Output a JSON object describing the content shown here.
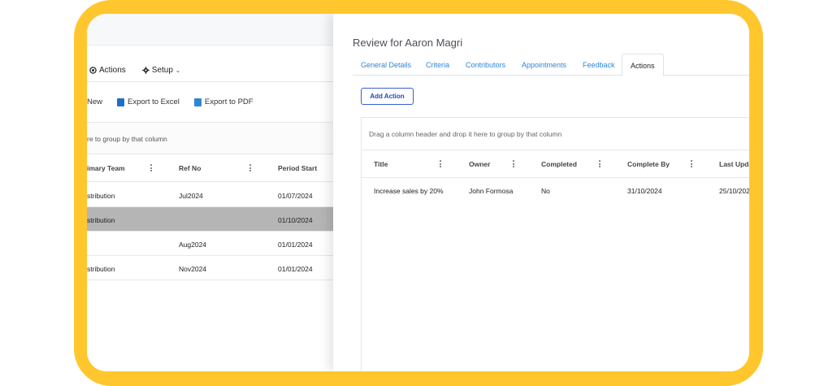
{
  "background": {
    "menu": [
      {
        "label": "Actions",
        "icon": "target-icon"
      },
      {
        "label": "Setup",
        "icon": "gear-icon"
      }
    ],
    "toolbar": {
      "new_label": "New",
      "export_excel_label": "Export to Excel",
      "export_pdf_label": "Export to PDF"
    },
    "group_hint": "re to group by that column",
    "columns": [
      "imary Team",
      "Ref No",
      "Period Start"
    ],
    "rows": [
      {
        "team": "stribution",
        "ref": "Jul2024",
        "start": "01/07/2024"
      },
      {
        "team": "stribution",
        "ref": "",
        "start": "01/10/2024"
      },
      {
        "team": "",
        "ref": "Aug2024",
        "start": "01/01/2024"
      },
      {
        "team": "stribution",
        "ref": "Nov2024",
        "start": "01/01/2024"
      }
    ]
  },
  "panel": {
    "title": "Review for Aaron Magri",
    "tabs": [
      "General Details",
      "Criteria",
      "Contributors",
      "Appointments",
      "Feedback",
      "Actions"
    ],
    "active_tab": "Actions",
    "add_button": "Add Action",
    "group_hint": "Drag a column header and drop it here to group by that column",
    "columns": [
      "Title",
      "Owner",
      "Completed",
      "Complete By",
      "Last Upda"
    ],
    "rows": [
      {
        "title": "Increase sales by 20%",
        "owner": "John Formosa",
        "completed": "No",
        "complete_by": "31/10/2024",
        "last_updated": "25/10/202"
      }
    ]
  },
  "colors": {
    "frame": "#FFC62E",
    "link": "#2f86d8",
    "button_border": "#3b5bdb",
    "selected_row": "#b5b5b5"
  }
}
